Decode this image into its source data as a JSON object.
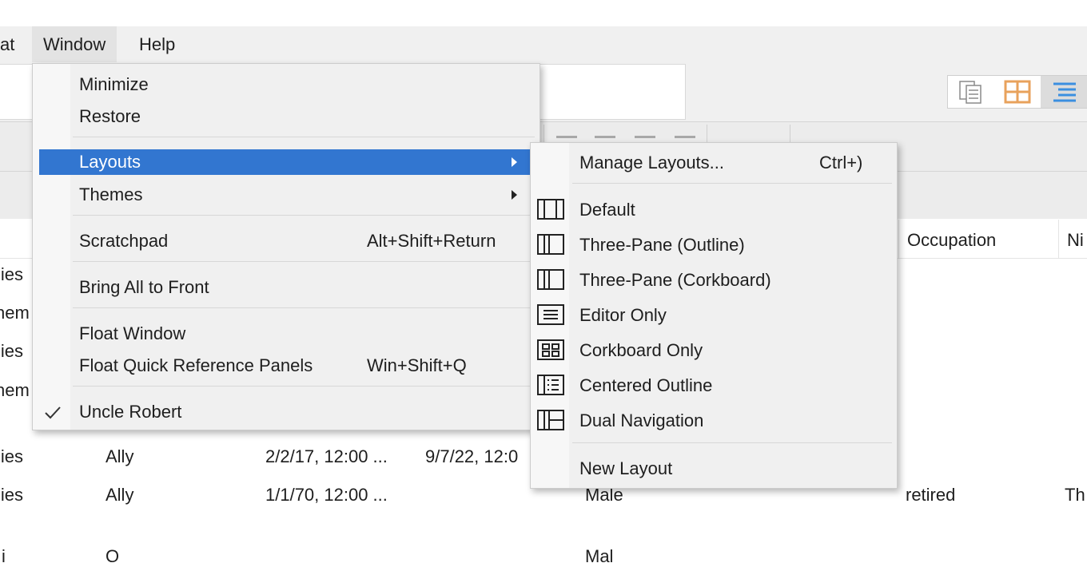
{
  "menubar": {
    "items": [
      {
        "label": "at"
      },
      {
        "label": "Window"
      },
      {
        "label": "Help"
      }
    ]
  },
  "table": {
    "headers": [
      {
        "label": "Occupation"
      },
      {
        "label": "Ni"
      }
    ],
    "rows": [
      {
        "col1": "lies"
      },
      {
        "col1": "nem"
      },
      {
        "col1": "lies"
      },
      {
        "col1": "nem"
      },
      {
        "col1": "lies",
        "col2": "Ally",
        "col3": "2/2/17, 12:00 ...",
        "col4": "9/7/22, 12:0"
      },
      {
        "col1": "lies",
        "col2": "Ally",
        "col3": "1/1/70, 12:00 ...",
        "col5": "Male",
        "col6": "retired",
        "col7": "Th"
      },
      {
        "col1": "i",
        "col2": "O",
        "col5": "Mal"
      }
    ]
  },
  "window_menu": {
    "items": [
      {
        "label": "Minimize"
      },
      {
        "label": "Restore"
      },
      {
        "label": "Layouts"
      },
      {
        "label": "Themes"
      },
      {
        "label": "Scratchpad",
        "shortcut": "Alt+Shift+Return"
      },
      {
        "label": "Bring All to Front"
      },
      {
        "label": "Float Window"
      },
      {
        "label": "Float Quick Reference Panels",
        "shortcut": "Win+Shift+Q"
      },
      {
        "label": "Uncle Robert",
        "checked": true
      }
    ],
    "highlighted": "Layouts"
  },
  "layouts_submenu": {
    "items": [
      {
        "label": "Manage Layouts...",
        "shortcut": "Ctrl+)"
      },
      {
        "label": "Default",
        "icon": "layout-default-icon"
      },
      {
        "label": "Three-Pane (Outline)",
        "icon": "layout-three-pane-outline-icon"
      },
      {
        "label": "Three-Pane (Corkboard)",
        "icon": "layout-three-pane-corkboard-icon"
      },
      {
        "label": "Editor Only",
        "icon": "layout-editor-only-icon"
      },
      {
        "label": "Corkboard Only",
        "icon": "layout-corkboard-only-icon"
      },
      {
        "label": "Centered Outline",
        "icon": "layout-centered-outline-icon"
      },
      {
        "label": "Dual Navigation",
        "icon": "layout-dual-navigation-icon"
      },
      {
        "label": "New Layout"
      }
    ]
  },
  "view_buttons": [
    {
      "icon": "document-view-icon"
    },
    {
      "icon": "corkboard-view-icon",
      "color": "#e8a25c"
    },
    {
      "icon": "outline-view-icon",
      "color": "#3b8fe0"
    }
  ],
  "colors": {
    "highlight": "#3276d0",
    "menu_bg": "#f0f0f0"
  }
}
